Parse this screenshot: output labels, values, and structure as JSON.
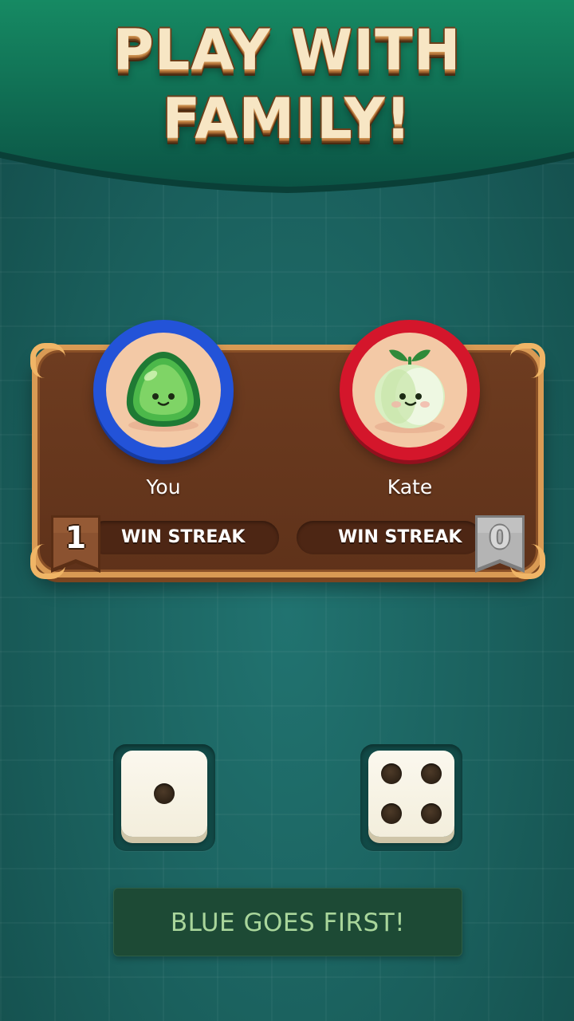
{
  "title": {
    "line1": "PLAY WITH",
    "line2": "FAMILY!"
  },
  "players": {
    "left": {
      "name": "You",
      "color": "blue",
      "avatar": "green-slime-avatar",
      "streak_label": "WIN STREAK",
      "streak_count": "1"
    },
    "right": {
      "name": "Kate",
      "color": "red",
      "avatar": "onion-sprout-avatar",
      "streak_label": "WIN STREAK",
      "streak_count": "0"
    }
  },
  "dice": {
    "left_value": 1,
    "right_value": 4
  },
  "status": {
    "message": "BLUE GOES FIRST!"
  },
  "colors": {
    "background": "#1d6562",
    "header": "#0f6a4f",
    "panel": "#6e3c20",
    "panel_border": "#d99a54",
    "blue_ring": "#2353d8",
    "red_ring": "#d4162b",
    "status_text": "#a9d69b"
  }
}
